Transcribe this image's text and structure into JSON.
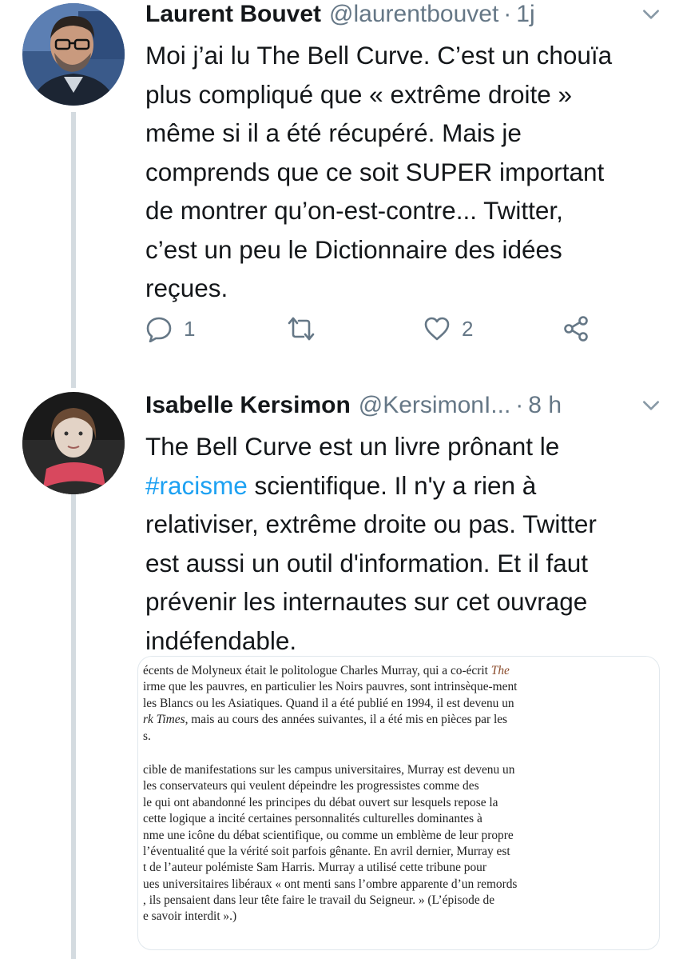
{
  "tweets": [
    {
      "name": "Laurent Bouvet",
      "handle": "@laurentbouvet",
      "dot": "·",
      "time": "1j",
      "text_lines": [
        "Moi j’ai lu The Bell Curve. C’est un chouïa",
        "plus compliqué que « extrême droite »",
        "même si il a été récupéré. Mais je",
        "comprends que ce soit SUPER important",
        "de montrer qu’on-est-contre... Twitter,",
        "c’est un peu le Dictionnaire des idées",
        "reçues."
      ],
      "reply_count": "1",
      "like_count": "2"
    },
    {
      "name": "Isabelle Kersimon",
      "handle": "@KersimonI...",
      "dot": "·",
      "time": "8 h",
      "line1": "The Bell Curve est un livre prônant le",
      "hashtag": "#racisme",
      "line2_rest": " scientifique. Il n'y a rien à",
      "text_lines": [
        "relativiser, extrême droite ou pas. Twitter",
        "est aussi un outil d'information. Et il faut",
        "prévenir les internautes sur cet ouvrage",
        "indéfendable."
      ]
    }
  ],
  "media_text": {
    "p1": [
      {
        "pre": "écents de Molyneux était le politologue Charles Murray, qui a co-écrit ",
        "ital": "The",
        "post": ""
      },
      {
        "pre": "irme que les pauvres, en particulier les Noirs pauvres, sont intrinsèque-ment",
        "ital": "",
        "post": ""
      },
      {
        "pre": " les Blancs ou les Asiatiques. Quand il a été publié en 1994, il est devenu un",
        "ital": "",
        "post": ""
      },
      {
        "pre": "",
        "ital": "rk Times",
        "post": ", mais au cours des années suivantes, il a été mis en pièces par les"
      },
      {
        "pre": "s.",
        "ital": "",
        "post": ""
      }
    ],
    "p2": [
      "cible de manifestations sur les campus universitaires, Murray est devenu un",
      " les conservateurs qui veulent dépeindre les progressistes comme des",
      "le qui ont abandonné les principes du débat ouvert sur lesquels repose la",
      "cette logique a incité certaines personnalités culturelles dominantes à",
      "nme une icône du débat scientifique, ou comme un emblème de leur propre",
      " l’éventualité que la vérité soit parfois gênante. En avril dernier, Murray est",
      "t de l’auteur polémiste Sam Harris. Murray a utilisé cette tribune pour",
      "ues universitaires libéraux « ont menti sans l’ombre apparente d’un remords",
      ", ils pensaient dans leur tête faire le travail du Seigneur. » (L’épisode de",
      "e savoir interdit ».)"
    ]
  },
  "colors": {
    "text": "#14171a",
    "muted": "#657786",
    "link": "#1da1f2",
    "thread_line": "#d4dbe0"
  },
  "icons": [
    "reply-icon",
    "retweet-icon",
    "like-icon",
    "share-icon",
    "chevron-down-icon"
  ]
}
